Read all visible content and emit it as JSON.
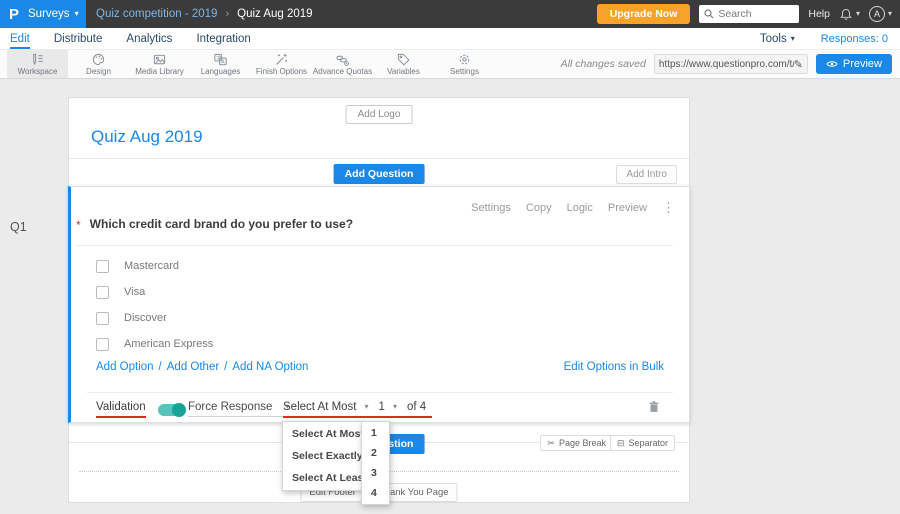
{
  "colors": {
    "accent_blue": "#1b87e6",
    "header_dark": "#3b3b3b",
    "upgrade_orange": "#f7a228",
    "toggle_teal": "#17a397",
    "annotation_red": "#e02b20",
    "page_background": "#ebebeb"
  },
  "icons": {
    "caret": "▾",
    "breadcrumb_separator": "›",
    "pencil": "✎",
    "scissors": "✂",
    "separator_glyph": "⊟",
    "ellipsis": "⋮",
    "required_marker": "*",
    "link_slash": "/"
  },
  "topbar": {
    "logo_letter": "P",
    "product_menu": "Surveys",
    "breadcrumb_parent": "Quiz competition - 2019",
    "breadcrumb_current": "Quiz Aug 2019",
    "upgrade_button": "Upgrade Now",
    "search_placeholder": "Search",
    "help_label": "Help",
    "avatar_initial": "A"
  },
  "navbar": {
    "tabs": [
      "Edit",
      "Distribute",
      "Analytics",
      "Integration"
    ],
    "active_tab": "Edit",
    "tools_label": "Tools",
    "responses_label": "Responses: 0"
  },
  "toolbar": {
    "items": [
      "Workspace",
      "Design",
      "Media Library",
      "Languages",
      "Finish Options",
      "Advance Quotas",
      "Variables",
      "Settings"
    ],
    "active_item": "Workspace",
    "save_status": "All changes saved",
    "share_url": "https://www.questionpro.com/t/APNrFZ",
    "preview_button": "Preview"
  },
  "survey": {
    "add_logo_button": "Add Logo",
    "title": "Quiz Aug 2019",
    "add_question_button": "Add Question",
    "add_intro_button": "Add Intro",
    "question_label": "Q1",
    "question_text": "Which credit card brand do you prefer to use?",
    "actions": [
      "Settings",
      "Copy",
      "Logic",
      "Preview"
    ],
    "options": [
      "Mastercard",
      "Visa",
      "Discover",
      "American Express"
    ],
    "option_links": [
      "Add Option",
      "Add Other",
      "Add NA Option"
    ],
    "bulk_edit_link": "Edit Options in Bulk",
    "validation_label": "Validation",
    "force_response_label": "Force Response",
    "rule_selected": "Select At Most",
    "count_selected": "1",
    "of_total": "of 4",
    "rule_menu": [
      "Select At Most",
      "Select Exactly",
      "Select At Least"
    ],
    "count_menu": [
      "1",
      "2",
      "3",
      "4"
    ],
    "page_break_button": "Page Break",
    "separator_button": "Separator",
    "edit_footer_button": "Edit Footer",
    "thank_you_button": "Thank You Page"
  }
}
